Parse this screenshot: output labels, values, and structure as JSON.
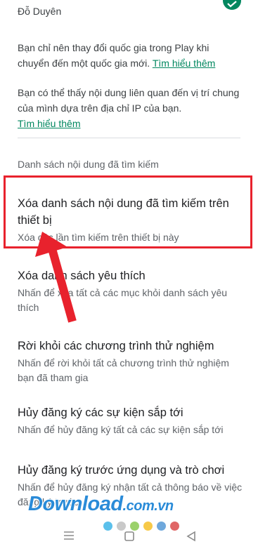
{
  "account": {
    "name": "Đỗ Duyên"
  },
  "info": {
    "country_text": "Bạn chỉ nên thay đổi quốc gia trong Play khi chuyển đến một quốc gia mới.",
    "country_link": "Tìm hiểu thêm",
    "ip_text": "Bạn có thể thấy nội dung liên quan đến vị trí chung của mình dựa trên địa chỉ IP của bạn.",
    "ip_link": "Tìm hiểu thêm"
  },
  "section": {
    "header": "Danh sách nội dung đã tìm kiếm"
  },
  "items": [
    {
      "title": "Xóa danh sách nội dung đã tìm kiếm trên thiết bị",
      "subtitle": "Xóa các lần tìm kiếm trên thiết bị này"
    },
    {
      "title": "Xóa danh sách yêu thích",
      "subtitle": "Nhấn để xóa tất cả các mục khỏi danh sách yêu thích"
    },
    {
      "title": "Rời khỏi các chương trình thử nghiệm",
      "subtitle": "Nhấn để rời khỏi tất cả chương trình thử nghiệm bạn đã tham gia"
    },
    {
      "title": "Hủy đăng ký các sự kiện sắp tới",
      "subtitle": "Nhấn để hủy đăng ký tất cả các sự kiện sắp tới"
    },
    {
      "title": "Hủy đăng ký trước ứng dụng và trò chơi",
      "subtitle": "Nhấn để hủy đăng ký nhận tất cả thông báo về việc đăng ký trước"
    }
  ],
  "watermark": {
    "brand": "Download",
    "domain": ".com.vn"
  },
  "colors": {
    "accent": "#01875f",
    "highlight": "#e8222d",
    "watermark": "#2a8bd8"
  },
  "watermark_dots": [
    "#5bc0eb",
    "#c9c9c9",
    "#9bd16b",
    "#f7c948",
    "#6fa8dc",
    "#e06666"
  ],
  "nav": {
    "icons": [
      "menu-icon",
      "home-icon",
      "back-icon"
    ]
  }
}
